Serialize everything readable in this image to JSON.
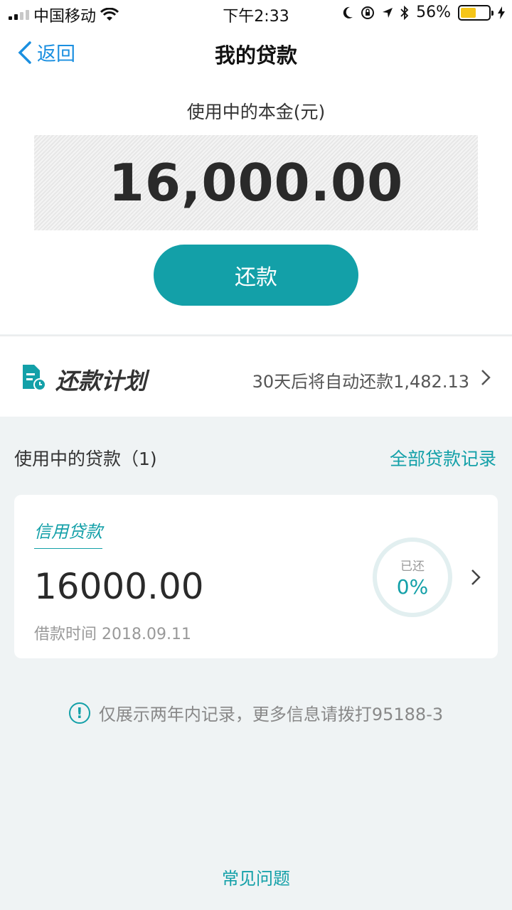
{
  "status_bar": {
    "carrier": "中国移动",
    "time": "下午2:33",
    "battery": "56%",
    "battery_level": 0.56
  },
  "nav": {
    "back_label": "返回",
    "title": "我的贷款"
  },
  "principal": {
    "label": "使用中的本金(元)",
    "amount": "16,000.00",
    "button_label": "还款"
  },
  "plan": {
    "title": "还款计划",
    "description": "30天后将自动还款1,482.13"
  },
  "loans_section": {
    "title": "使用中的贷款（1)",
    "link": "全部贷款记录"
  },
  "loan_card": {
    "type": "信用贷款",
    "amount": "16000.00",
    "date": "借款时间 2018.09.11",
    "repaid_label": "已还",
    "repaid_value": "0%"
  },
  "notice": {
    "icon_text": "!",
    "text": "仅展示两年内记录，更多信息请拨打95188-3"
  },
  "faq": {
    "label": "常见问题"
  },
  "colors": {
    "accent": "#13a0a8",
    "link_blue": "#1a8fe0",
    "battery": "#f5c518"
  }
}
